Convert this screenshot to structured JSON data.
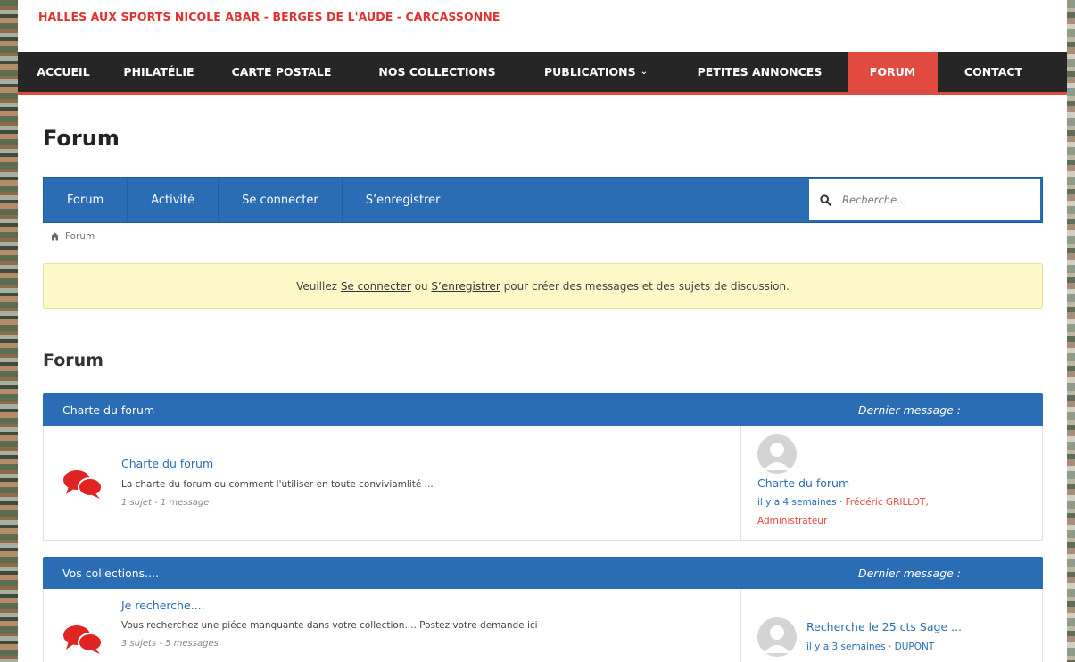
{
  "site": {
    "title": "HALLES AUX SPORTS NICOLE ABAR - BERGES DE L'AUDE - CARCASSONNE"
  },
  "mainnav": {
    "items": [
      {
        "label": "ACCUEIL"
      },
      {
        "label": "PHILATÉLIE"
      },
      {
        "label": "CARTE POSTALE"
      },
      {
        "label": "NOS COLLECTIONS"
      },
      {
        "label": "PUBLICATIONS"
      },
      {
        "label": "PETITES ANNONCES"
      },
      {
        "label": "FORUM"
      },
      {
        "label": "CONTACT"
      }
    ],
    "active": "FORUM",
    "accent": "#e14a3f"
  },
  "page": {
    "heading": "Forum"
  },
  "forum_nav": {
    "tabs": [
      {
        "label": "Forum"
      },
      {
        "label": "Activité"
      },
      {
        "label": "Se connecter"
      },
      {
        "label": "S’enregistrer"
      }
    ],
    "search_placeholder": "Recherche...",
    "color": "#2b6db4"
  },
  "breadcrumb": {
    "label": "Forum"
  },
  "notice": {
    "prefix": "Veuillez",
    "login": "Se connecter",
    "middle": "ou",
    "register": "S’enregistrer",
    "suffix": "pour créer des messages et des sujets de discussion."
  },
  "section": {
    "title": "Forum"
  },
  "categories": [
    {
      "name": "Charte du forum",
      "last_label": "Dernier message :",
      "forum": {
        "title": "Charte du forum",
        "description": "La charte du forum ou comment l'utiliser en toute conviviamlité ...",
        "stats": "1 sujet - 1 message"
      },
      "last": {
        "title": "Charte du forum",
        "time": "il y a 4 semaines",
        "sep": "·",
        "author": "Frédéric GRILLOT, Administrateur"
      }
    },
    {
      "name": "Vos collections....",
      "last_label": "Dernier message :",
      "forum": {
        "title": "Je recherche....",
        "description": "Vous recherchez une piéce manquante dans votre collection.... Postez votre demande ici",
        "stats": "3 sujets - 5 messages"
      },
      "last": {
        "title": "Recherche le 25 cts  Sage ...",
        "time": "il y a 3 semaines",
        "sep": "·",
        "author": "DUPONT"
      }
    }
  ]
}
